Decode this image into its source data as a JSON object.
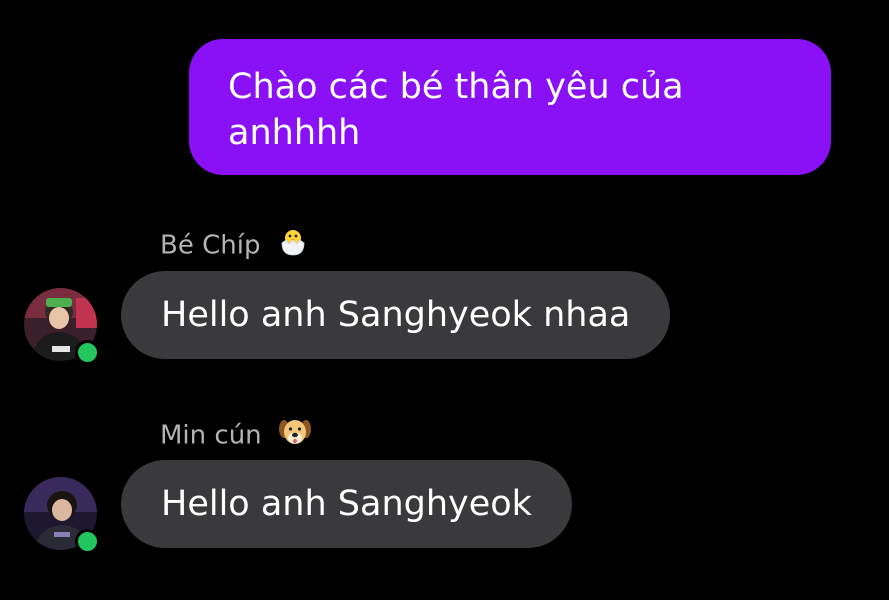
{
  "messages": {
    "outgoing": {
      "text": "Chào các bé thân yêu của anhhhh"
    },
    "incoming": [
      {
        "sender": "Bé Chíp",
        "sender_emoji": "hatching-chick-icon",
        "text": "Hello anh Sanghyeok nhaa",
        "online": true
      },
      {
        "sender": "Min cún",
        "sender_emoji": "dog-face-icon",
        "text": "Hello anh Sanghyeok",
        "online": true
      }
    ]
  },
  "colors": {
    "background": "#000000",
    "outgoing_bubble": "#8a10f5",
    "incoming_bubble": "#3a3a3c",
    "sender_name": "#b3b3b3",
    "online_dot": "#22c55e"
  }
}
